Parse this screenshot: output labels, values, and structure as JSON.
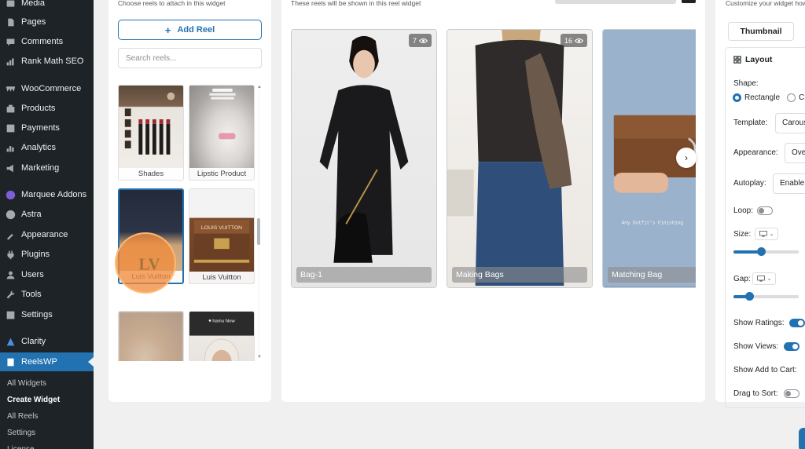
{
  "sidebar": {
    "menu": [
      {
        "label": "Media",
        "icon": "media-icon"
      },
      {
        "label": "Pages",
        "icon": "pages-icon"
      },
      {
        "label": "Comments",
        "icon": "comments-icon"
      },
      {
        "label": "Rank Math SEO",
        "icon": "rank-math-icon"
      },
      {
        "label": "WooCommerce",
        "icon": "woocommerce-icon"
      },
      {
        "label": "Products",
        "icon": "products-icon"
      },
      {
        "label": "Payments",
        "icon": "payments-icon"
      },
      {
        "label": "Analytics",
        "icon": "analytics-icon"
      },
      {
        "label": "Marketing",
        "icon": "marketing-icon"
      },
      {
        "label": "Marquee Addons",
        "icon": "marquee-addons-icon"
      },
      {
        "label": "Astra",
        "icon": "astra-icon"
      },
      {
        "label": "Appearance",
        "icon": "appearance-icon"
      },
      {
        "label": "Plugins",
        "icon": "plugins-icon"
      },
      {
        "label": "Users",
        "icon": "users-icon"
      },
      {
        "label": "Tools",
        "icon": "tools-icon"
      },
      {
        "label": "Settings",
        "icon": "settings-icon"
      },
      {
        "label": "Clarity",
        "icon": "clarity-icon"
      },
      {
        "label": "ReelsWP",
        "icon": "reelswp-icon"
      }
    ],
    "submenu": [
      "All Widgets",
      "Create Widget",
      "All Reels",
      "Settings",
      "License"
    ],
    "active_submenu": "Create Widget"
  },
  "reel_picker": {
    "hint": "Choose reels to attach in this widget",
    "add_button": "Add Reel",
    "search_placeholder": "Search reels...",
    "thumbnails": [
      "Shades",
      "Lipstic Product",
      "Luis Vuitton",
      "Luis Vuitton",
      "",
      ""
    ],
    "selected_index": 2
  },
  "preview": {
    "hint": "These reels will be shown in this reel widget",
    "reels": [
      {
        "title": "Bag-1",
        "views": "7"
      },
      {
        "title": "Making Bags",
        "views": "16"
      },
      {
        "title": "Matching Bag",
        "views": ""
      }
    ]
  },
  "settings": {
    "hint": "Customize your widget how",
    "tab": "Thumbnail",
    "section_title": "Layout",
    "shape_label": "Shape:",
    "shape_options": [
      "Rectangle",
      "C"
    ],
    "shape_selected": "Rectangle",
    "template_label": "Template:",
    "template_value": "Carousel",
    "appearance_label": "Appearance:",
    "appearance_value": "Overlay",
    "autoplay_label": "Autoplay:",
    "autoplay_value": "Enable",
    "loop_label": "Loop:",
    "loop_on": false,
    "size_label": "Size:",
    "size_level": 0.42,
    "gap_label": "Gap:",
    "gap_level": 0.24,
    "show_ratings_label": "Show Ratings:",
    "show_ratings_on": true,
    "show_views_label": "Show Views:",
    "show_views_on": true,
    "show_add_to_cart_label": "Show Add to Cart:",
    "drag_to_sort_label": "Drag to Sort:",
    "drag_to_sort_on": false
  },
  "colors": {
    "sidebar_bg": "#1d2327",
    "accent": "#2271b1",
    "page_bg": "#f0f0f1",
    "click_marker": "#f18c3c"
  }
}
